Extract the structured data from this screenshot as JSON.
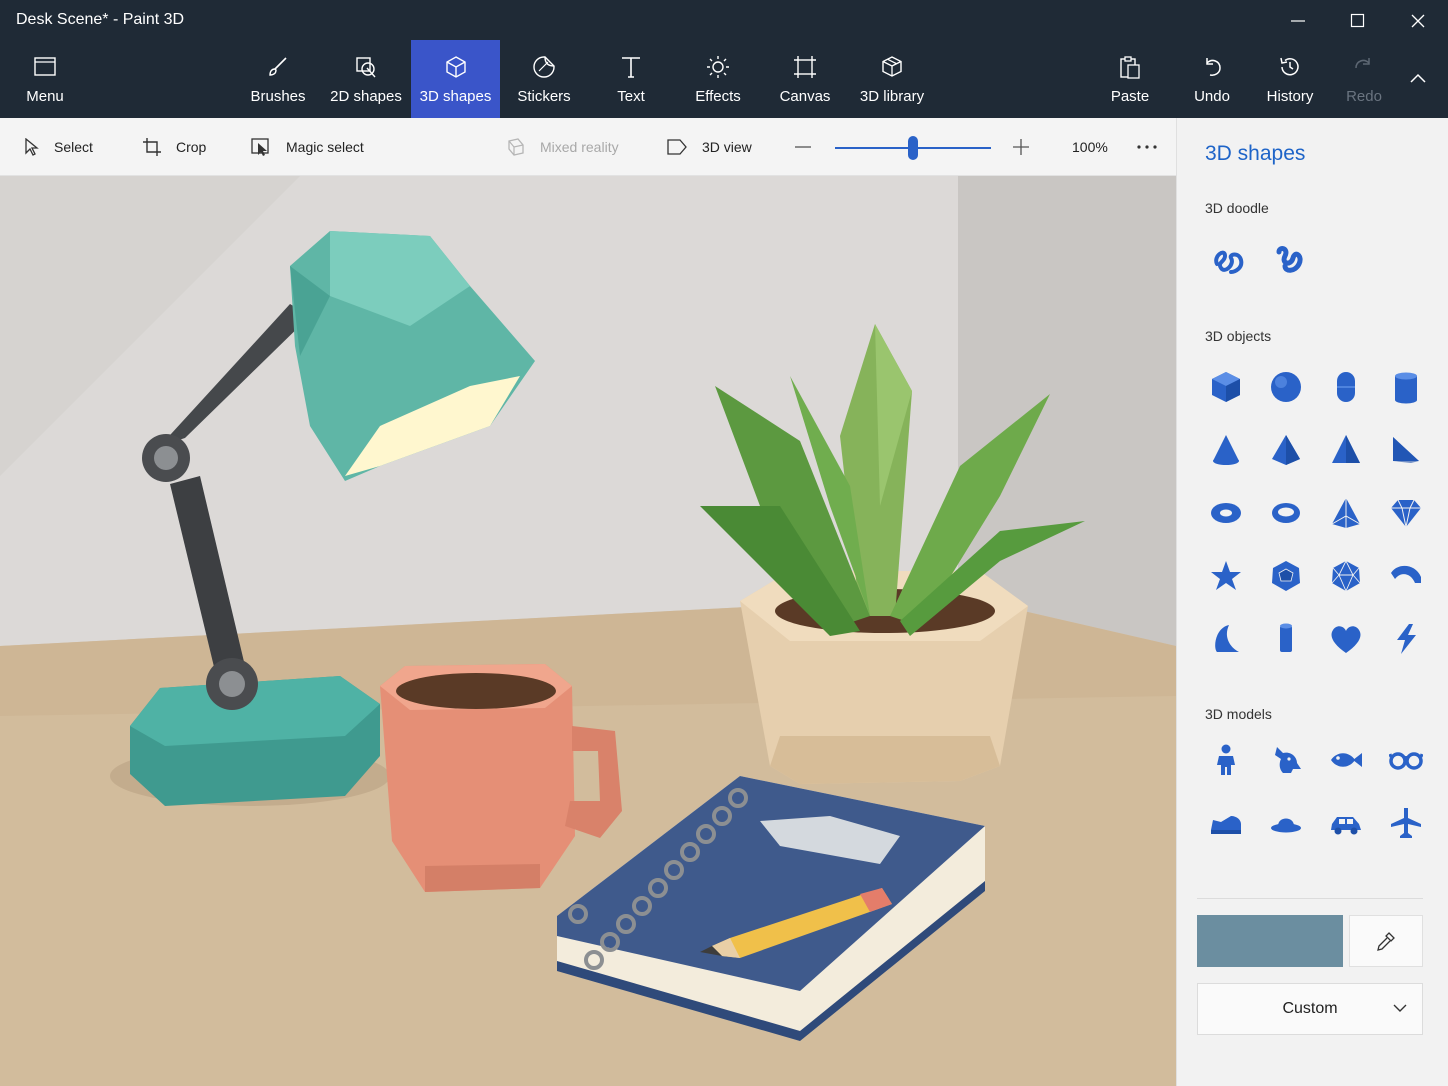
{
  "window": {
    "title": "Desk Scene* - Paint 3D"
  },
  "ribbon": {
    "menu": "Menu",
    "brushes": "Brushes",
    "shapes_2d": "2D shapes",
    "shapes_3d": "3D shapes",
    "stickers": "Stickers",
    "text": "Text",
    "effects": "Effects",
    "canvas": "Canvas",
    "library_3d": "3D library",
    "paste": "Paste",
    "undo": "Undo",
    "history": "History",
    "redo": "Redo",
    "active_tab": "3D shapes"
  },
  "toolbar": {
    "select": "Select",
    "crop": "Crop",
    "magic_select": "Magic select",
    "mixed_reality": "Mixed reality",
    "view_3d": "3D view",
    "zoom": "100%",
    "zoom_level": 0.5
  },
  "panel": {
    "title": "3D shapes",
    "doodle_heading": "3D doodle",
    "doodles": [
      "sharp-edge-doodle-icon",
      "soft-edge-doodle-icon"
    ],
    "objects_heading": "3D objects",
    "objects": [
      "cube-icon",
      "sphere-icon",
      "capsule-icon",
      "cylinder-icon",
      "cone-icon",
      "pyramid-icon",
      "tetrahedron-icon",
      "wedge-icon",
      "torus-icon",
      "ring-icon",
      "triangular-prism-icon",
      "gem-icon",
      "star-icon",
      "dodecahedron-icon",
      "icosahedron-icon",
      "arch-icon",
      "crescent-icon",
      "tube-icon",
      "heart-icon",
      "lightning-icon"
    ],
    "models_heading": "3D models",
    "models": [
      "person-icon",
      "dog-icon",
      "fish-icon",
      "glasses-icon",
      "shoe-icon",
      "hat-icon",
      "car-icon",
      "airplane-icon"
    ],
    "color_name": "Custom",
    "current_color": "#6b8ea0"
  },
  "colors": {
    "ribbon_bg": "#1f2a36",
    "accent": "#3a55c9",
    "shape_blue": "#2a62c8"
  }
}
